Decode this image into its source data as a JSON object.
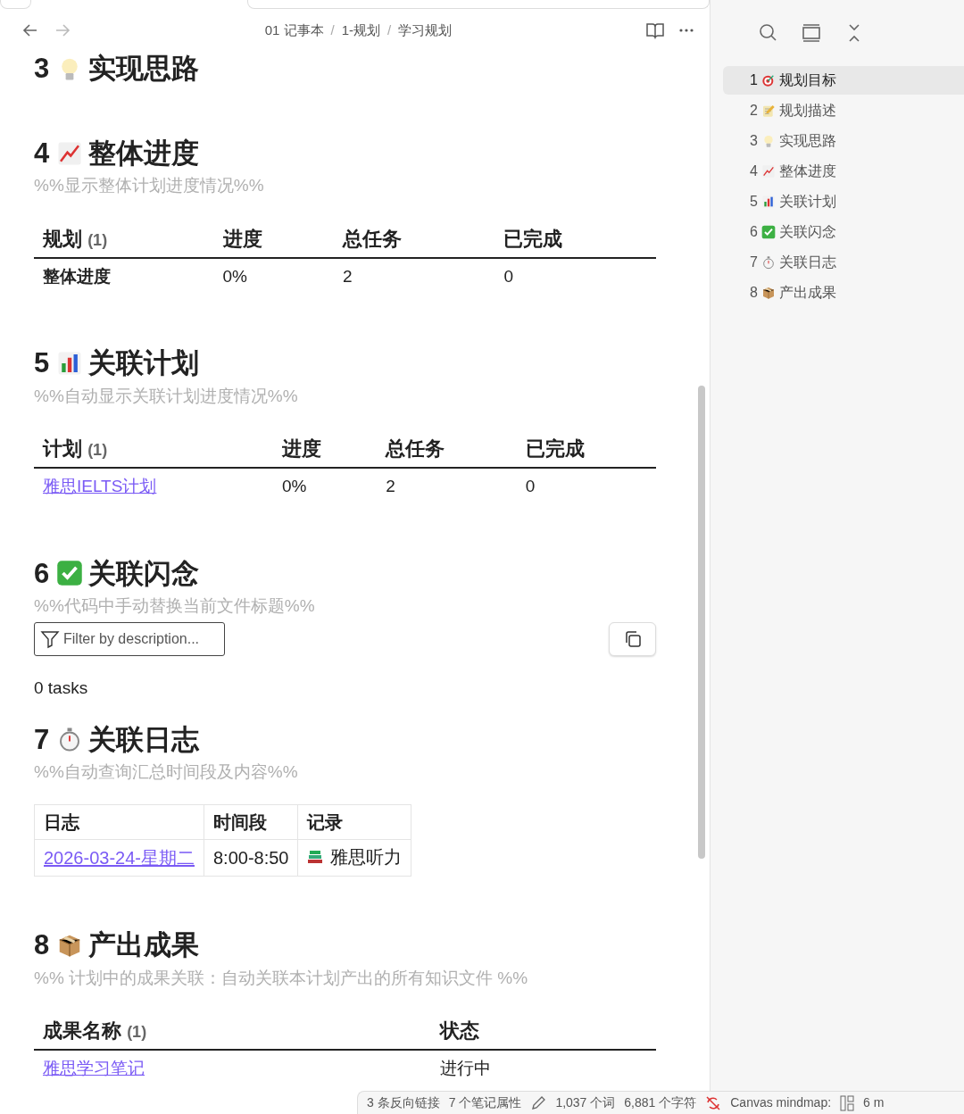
{
  "nav": {
    "back": {
      "disabled": false
    },
    "forward": {
      "disabled": true
    },
    "breadcrumb": {
      "items": [
        "01 记事本",
        "1-规划",
        "学习规划"
      ],
      "separator": "/"
    }
  },
  "sections": [
    {
      "number": "3",
      "title": "实现思路"
    },
    {
      "number": "4",
      "title": "整体进度",
      "comment": "%%显示整体计划进度情况%%",
      "table": {
        "columns": [
          {
            "label": "规划",
            "count": "(1)"
          },
          {
            "label": "进度"
          },
          {
            "label": "总任务"
          },
          {
            "label": "已完成"
          }
        ],
        "rows": [
          [
            {
              "text": "整体进度",
              "bold": true
            },
            {
              "text": "0%"
            },
            {
              "text": "2"
            },
            {
              "text": "0"
            }
          ]
        ]
      }
    },
    {
      "number": "5",
      "title": "关联计划",
      "comment": "%%自动显示关联计划进度情况%%",
      "table": {
        "columns": [
          {
            "label": "计划",
            "count": "(1)"
          },
          {
            "label": "进度"
          },
          {
            "label": "总任务"
          },
          {
            "label": "已完成"
          }
        ],
        "rows": [
          [
            {
              "text": "雅思IELTS计划",
              "link": true
            },
            {
              "text": "0%"
            },
            {
              "text": "2"
            },
            {
              "text": "0"
            }
          ]
        ]
      }
    },
    {
      "number": "6",
      "title": "关联闪念",
      "comment": "%%代码中手动替换当前文件标题%%",
      "tasks": {
        "placeholder": "Filter by description...",
        "count": "0 tasks"
      }
    },
    {
      "number": "7",
      "title": "关联日志",
      "comment": "%%自动查询汇总时间段及内容%%",
      "grid": {
        "columns": [
          "日志",
          "时间段",
          "记录"
        ],
        "rows": [
          [
            {
              "text": "2026-03-24-星期二",
              "link": true
            },
            {
              "text": "8:00-8:50"
            },
            {
              "text": "雅思听力",
              "book": true
            }
          ]
        ]
      }
    },
    {
      "number": "8",
      "title": "产出成果",
      "comment": "%% 计划中的成果关联：自动关联本计划产出的所有知识文件 %%",
      "table": {
        "columns": [
          {
            "label": "成果名称",
            "count": "(1)"
          },
          {
            "label": "状态"
          }
        ],
        "rows": [
          [
            {
              "text": "雅思学习笔记",
              "link": true
            },
            {
              "text": "进行中"
            }
          ]
        ]
      }
    }
  ],
  "outline": [
    {
      "number": "1",
      "title": "规划目标",
      "selected": true
    },
    {
      "number": "2",
      "title": "规划描述",
      "selected": false
    },
    {
      "number": "3",
      "title": "实现思路",
      "selected": false
    },
    {
      "number": "4",
      "title": "整体进度",
      "selected": false
    },
    {
      "number": "5",
      "title": "关联计划",
      "selected": false
    },
    {
      "number": "6",
      "title": "关联闪念",
      "selected": false
    },
    {
      "number": "7",
      "title": "关联日志",
      "selected": false
    },
    {
      "number": "8",
      "title": "产出成果",
      "selected": false
    }
  ],
  "status_bar": {
    "backlinks": "3 条反向链接",
    "properties": "7 个笔记属性",
    "words": "1,037 个词",
    "chars": "6,881 个字符",
    "mindmap": "Canvas mindmap:",
    "cut": "6 m"
  }
}
